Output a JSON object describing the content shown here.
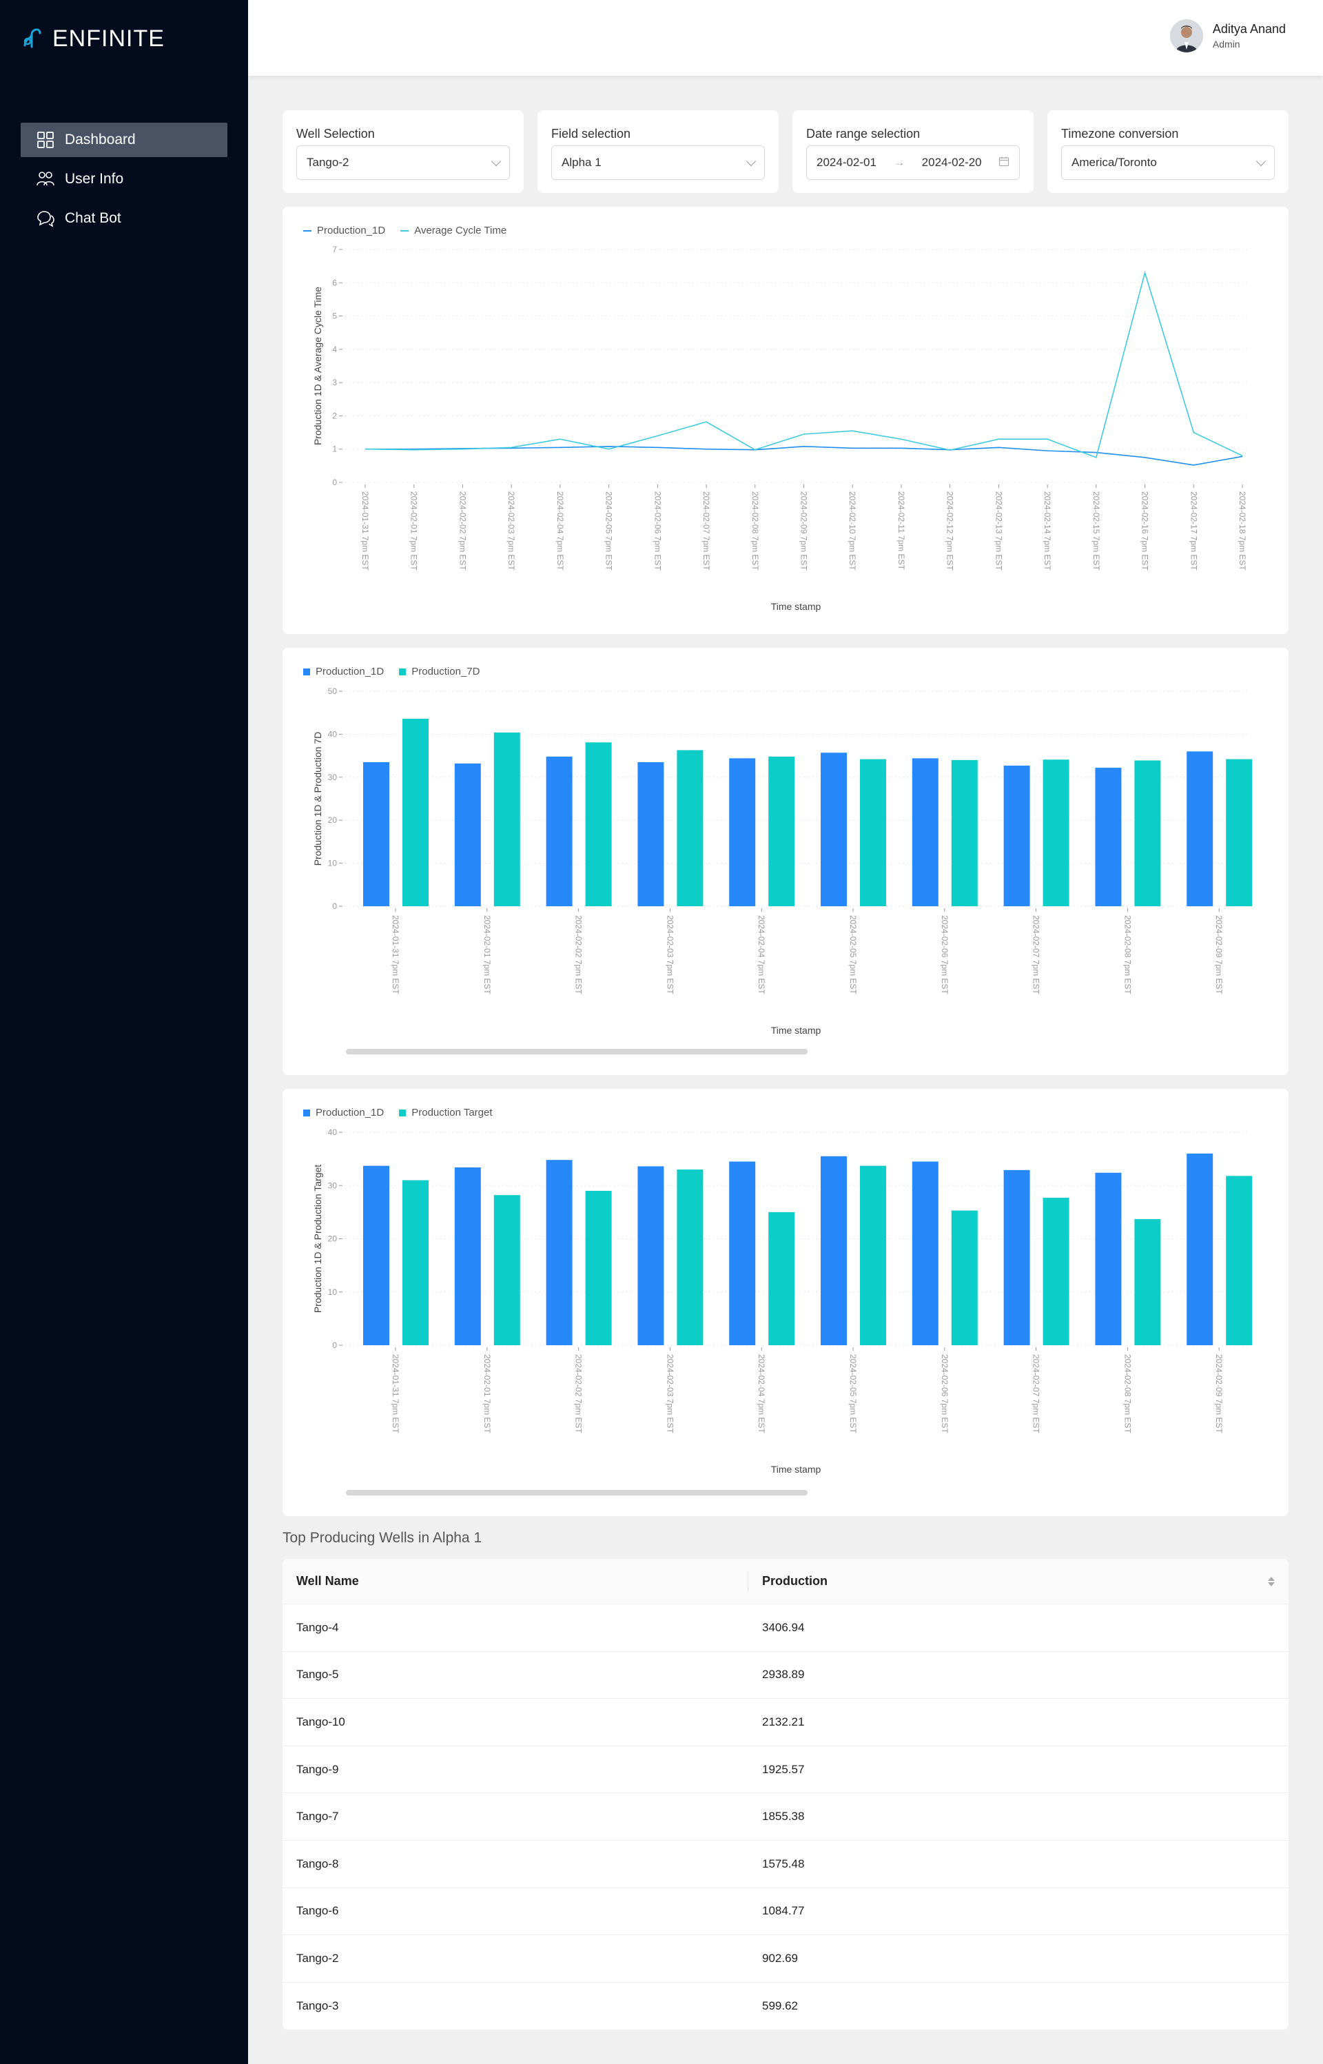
{
  "brand": {
    "name": "ENFINITE"
  },
  "sidebar": {
    "items": [
      {
        "label": "Dashboard",
        "icon": "dashboard-icon",
        "active": true
      },
      {
        "label": "User Info",
        "icon": "users-icon",
        "active": false
      },
      {
        "label": "Chat Bot",
        "icon": "chat-icon",
        "active": false
      }
    ]
  },
  "user": {
    "name": "Aditya Anand",
    "role": "Admin"
  },
  "filters": {
    "well": {
      "label": "Well Selection",
      "value": "Tango-2"
    },
    "field": {
      "label": "Field selection",
      "value": "Alpha 1"
    },
    "date": {
      "label": "Date range selection",
      "start": "2024-02-01",
      "end": "2024-02-20"
    },
    "timezone": {
      "label": "Timezone conversion",
      "value": "America/Toronto"
    }
  },
  "colors": {
    "blue": "#2688fb",
    "teal": "#0dcdc9",
    "line1": "#1f8ff0",
    "line2": "#3ecbe0"
  },
  "chart_data": [
    {
      "type": "line",
      "ylabel": "Production 1D & Average Cycle Time",
      "xlabel": "Time stamp",
      "ylim": [
        0,
        7
      ],
      "yticks": [
        "0",
        "1",
        "2",
        "3",
        "4",
        "5",
        "6",
        "7"
      ],
      "categories": [
        "2024-01-31 7pm EST",
        "2024-02-01 7pm EST",
        "2024-02-02 7pm EST",
        "2024-02-03 7pm EST",
        "2024-02-04 7pm EST",
        "2024-02-05 7pm EST",
        "2024-02-06 7pm EST",
        "2024-02-07 7pm EST",
        "2024-02-08 7pm EST",
        "2024-02-09 7pm EST",
        "2024-02-10 7pm EST",
        "2024-02-11 7pm EST",
        "2024-02-12 7pm EST",
        "2024-02-13 7pm EST",
        "2024-02-14 7pm EST",
        "2024-02-15 7pm EST",
        "2024-02-16 7pm EST",
        "2024-02-17 7pm EST",
        "2024-02-18 7pm EST"
      ],
      "series": [
        {
          "name": "Production_1D",
          "values": [
            1.0,
            1.0,
            1.02,
            1.03,
            1.05,
            1.08,
            1.05,
            1.0,
            0.98,
            1.08,
            1.03,
            1.03,
            0.98,
            1.05,
            0.95,
            0.9,
            0.75,
            0.52,
            0.78
          ]
        },
        {
          "name": "Average Cycle Time",
          "values": [
            1.0,
            0.98,
            1.0,
            1.05,
            1.3,
            1.0,
            1.4,
            1.82,
            0.98,
            1.45,
            1.55,
            1.3,
            0.97,
            1.3,
            1.3,
            0.75,
            6.3,
            1.5,
            0.8
          ]
        }
      ]
    },
    {
      "type": "bar",
      "ylabel": "Production 1D & Production 7D",
      "xlabel": "Time stamp",
      "ylim": [
        0,
        50
      ],
      "yticks": [
        "0",
        "10",
        "20",
        "30",
        "40",
        "50"
      ],
      "categories": [
        "2024-01-31 7pm EST",
        "2024-02-01 7pm EST",
        "2024-02-02 7pm EST",
        "2024-02-03 7pm EST",
        "2024-02-04 7pm EST",
        "2024-02-05 7pm EST",
        "2024-02-06 7pm EST",
        "2024-02-07 7pm EST",
        "2024-02-08 7pm EST",
        "2024-02-09 7pm EST"
      ],
      "series": [
        {
          "name": "Production_1D",
          "values": [
            33.5,
            33.2,
            34.8,
            33.5,
            34.4,
            35.7,
            34.4,
            32.7,
            32.2,
            36.0
          ]
        },
        {
          "name": "Production_7D",
          "values": [
            43.6,
            40.4,
            38.1,
            36.3,
            34.8,
            34.2,
            34.0,
            34.1,
            33.9,
            34.2
          ]
        }
      ]
    },
    {
      "type": "bar",
      "ylabel": "Production 1D & Production Target",
      "xlabel": "Time stamp",
      "ylim": [
        0,
        40
      ],
      "yticks": [
        "0",
        "10",
        "20",
        "30",
        "40"
      ],
      "categories": [
        "2024-01-31 7pm EST",
        "2024-02-01 7pm EST",
        "2024-02-02 7pm EST",
        "2024-02-03 7pm EST",
        "2024-02-04 7pm EST",
        "2024-02-05 7pm EST",
        "2024-02-06 7pm EST",
        "2024-02-07 7pm EST",
        "2024-02-08 7pm EST",
        "2024-02-09 7pm EST"
      ],
      "series": [
        {
          "name": "Production_1D",
          "values": [
            33.7,
            33.4,
            34.8,
            33.6,
            34.5,
            35.5,
            34.5,
            32.9,
            32.4,
            36.0
          ]
        },
        {
          "name": "Production Target",
          "values": [
            31.0,
            28.2,
            29.0,
            33.0,
            25.0,
            33.7,
            25.3,
            27.7,
            23.7,
            31.8
          ]
        }
      ]
    }
  ],
  "table": {
    "title": "Top Producing Wells in Alpha 1",
    "columns": [
      "Well Name",
      "Production"
    ],
    "rows": [
      [
        "Tango-4",
        "3406.94"
      ],
      [
        "Tango-5",
        "2938.89"
      ],
      [
        "Tango-10",
        "2132.21"
      ],
      [
        "Tango-9",
        "1925.57"
      ],
      [
        "Tango-7",
        "1855.38"
      ],
      [
        "Tango-8",
        "1575.48"
      ],
      [
        "Tango-6",
        "1084.77"
      ],
      [
        "Tango-2",
        "902.69"
      ],
      [
        "Tango-3",
        "599.62"
      ]
    ]
  }
}
